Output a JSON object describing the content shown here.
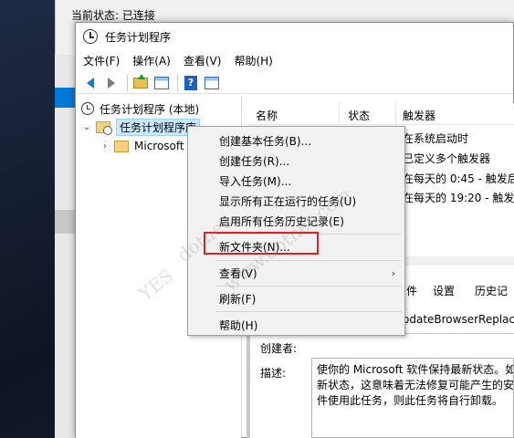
{
  "back_window": {
    "status_text": "当前状态: 已连接"
  },
  "window": {
    "title": "任务计划程序"
  },
  "menubar": [
    "文件(F)",
    "操作(A)",
    "查看(V)",
    "帮助(H)"
  ],
  "toolbar": {
    "icons": [
      "back-arrow-icon",
      "forward-arrow-icon",
      "folder-up-icon",
      "show-hide-tree-icon",
      "help-icon",
      "properties-icon"
    ]
  },
  "tree": {
    "root": "任务计划程序 (本地)",
    "library": "任务计划程序库",
    "child": "Microsoft"
  },
  "list": {
    "headers": [
      "名称",
      "状态",
      "触发器"
    ],
    "triggers": [
      "在系统启动时",
      "已定义多个触发器",
      "在每天的 0:45 - 触发后",
      "在每天的 19:20 - 触发后"
    ]
  },
  "tabs2": {
    "headers": [
      "件",
      "设置",
      "历史记"
    ]
  },
  "task_name_field": "odateBrowserReplace",
  "details": {
    "author_label": "创建者:",
    "desc_label": "描述:",
    "desc_lines": [
      "使你的 Microsoft 软件保持最新状态。如",
      "新状态，这意味着无法修复可能产生的安",
      "件使用此任务，则此任务将自行卸载。"
    ]
  },
  "context_menu": {
    "items": [
      "创建基本任务(B)...",
      "创建任务(R)...",
      "导入任务(M)...",
      "显示所有正在运行的任务(U)",
      "启用所有任务历史记录(E)",
      "新文件夹(N)...",
      "查看(V)",
      "刷新(F)",
      "帮助(H)"
    ],
    "submenu_arrow": "›",
    "highlighted_index": 5
  },
  "watermark": [
    "YES",
    "dotnet",
    "www.dotnet.com"
  ],
  "colors": {
    "accent": "#0078d7",
    "highlight": "#e02020",
    "selection": "#cce8ff"
  }
}
